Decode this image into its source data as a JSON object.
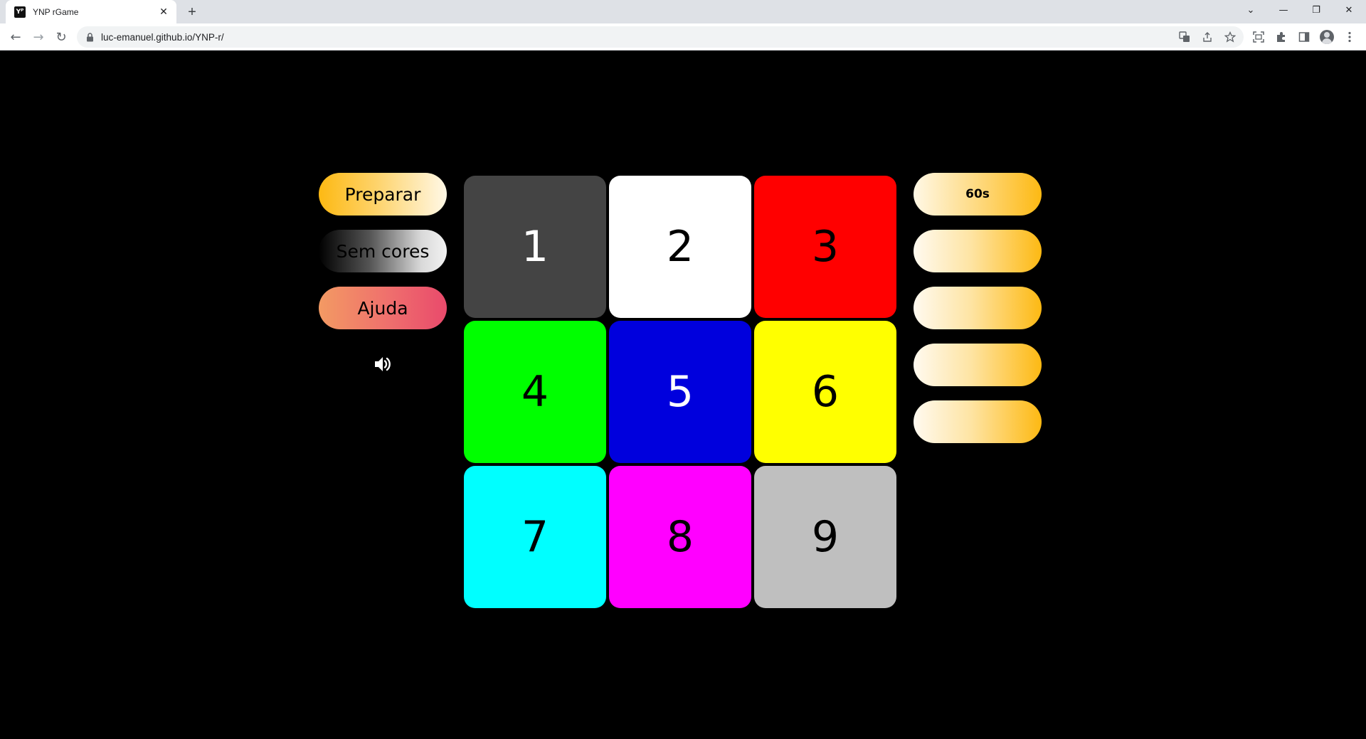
{
  "browser": {
    "tab_title": "YNP rGame",
    "tab_favicon": "Yᴾ",
    "close_glyph": "✕",
    "new_tab_glyph": "+",
    "url": "luc-emanuel.github.io/YNP-r/",
    "window_controls": {
      "dropdown": "⌄",
      "minimize": "—",
      "restore": "❐",
      "close": "✕"
    },
    "nav": {
      "back": "←",
      "forward": "→",
      "reload": "↻"
    }
  },
  "left_menu": {
    "prepare_label": "Preparar",
    "no_colors_label": "Sem cores",
    "help_label": "Ajuda",
    "sound_icon": "speaker-icon"
  },
  "grid": {
    "tiles": [
      {
        "label": "1",
        "bg": "#444444",
        "fg": "#ffffff"
      },
      {
        "label": "2",
        "bg": "#ffffff",
        "fg": "#000000"
      },
      {
        "label": "3",
        "bg": "#ff0000",
        "fg": "#000000"
      },
      {
        "label": "4",
        "bg": "#00ff00",
        "fg": "#000000"
      },
      {
        "label": "5",
        "bg": "#0000dd",
        "fg": "#ffffff"
      },
      {
        "label": "6",
        "bg": "#ffff00",
        "fg": "#000000"
      },
      {
        "label": "7",
        "bg": "#00ffff",
        "fg": "#000000"
      },
      {
        "label": "8",
        "bg": "#ff00ff",
        "fg": "#000000"
      },
      {
        "label": "9",
        "bg": "#bfbfbf",
        "fg": "#000000"
      }
    ]
  },
  "right_panel": {
    "timer": "60s",
    "slots": [
      "",
      "",
      "",
      ""
    ]
  }
}
